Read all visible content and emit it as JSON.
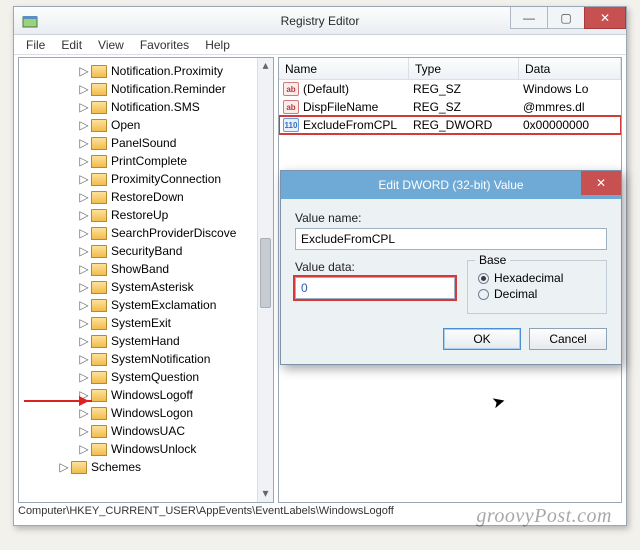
{
  "window": {
    "title": "Registry Editor",
    "menus": [
      "File",
      "Edit",
      "View",
      "Favorites",
      "Help"
    ],
    "statusbar": "Computer\\HKEY_CURRENT_USER\\AppEvents\\EventLabels\\WindowsLogoff"
  },
  "winbtns": {
    "min": "—",
    "max": "▢",
    "close": "✕"
  },
  "tree": {
    "items": [
      "Notification.Proximity",
      "Notification.Reminder",
      "Notification.SMS",
      "Open",
      "PanelSound",
      "PrintComplete",
      "ProximityConnection",
      "RestoreDown",
      "RestoreUp",
      "SearchProviderDiscove",
      "SecurityBand",
      "ShowBand",
      "SystemAsterisk",
      "SystemExclamation",
      "SystemExit",
      "SystemHand",
      "SystemNotification",
      "SystemQuestion",
      "WindowsLogoff",
      "WindowsLogon",
      "WindowsUAC",
      "WindowsUnlock"
    ],
    "parent": "Schemes",
    "selected_index": 18
  },
  "list": {
    "headers": {
      "name": "Name",
      "type": "Type",
      "data": "Data"
    },
    "rows": [
      {
        "icon": "str",
        "name": "(Default)",
        "type": "REG_SZ",
        "data": "Windows Lo"
      },
      {
        "icon": "str",
        "name": "DispFileName",
        "type": "REG_SZ",
        "data": "@mmres.dl"
      },
      {
        "icon": "dw",
        "name": "ExcludeFromCPL",
        "type": "REG_DWORD",
        "data": "0x00000000"
      }
    ],
    "highlight_index": 2
  },
  "dialog": {
    "title": "Edit DWORD (32-bit) Value",
    "labels": {
      "valuename": "Value name:",
      "valuedata": "Value data:",
      "base": "Base"
    },
    "valuename": "ExcludeFromCPL",
    "valuedata": "0",
    "base": {
      "hex": "Hexadecimal",
      "dec": "Decimal",
      "selected": "hex"
    },
    "buttons": {
      "ok": "OK",
      "cancel": "Cancel"
    },
    "close": "✕"
  },
  "watermark": "groovyPost.com"
}
